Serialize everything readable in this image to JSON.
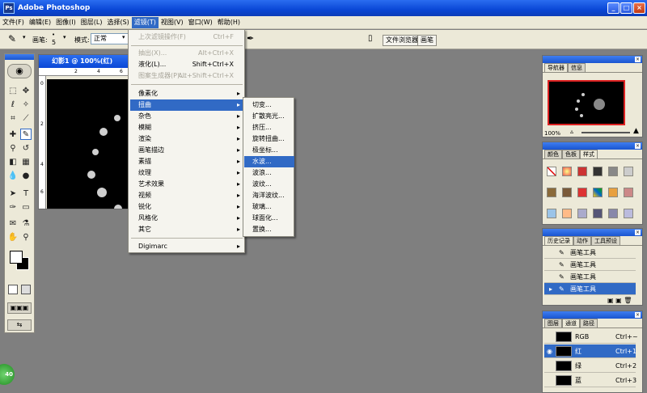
{
  "app": {
    "title": "Adobe Photoshop",
    "logo": "Ps"
  },
  "window_controls": {
    "minimize": "_",
    "maximize": "□",
    "close": "×"
  },
  "menubar": [
    "文件(F)",
    "编辑(E)",
    "图像(I)",
    "图层(L)",
    "选择(S)",
    "滤镜(T)",
    "视图(V)",
    "窗口(W)",
    "帮助(H)"
  ],
  "options": {
    "brush_label": "画笔:",
    "brush_size": "5",
    "mode_label": "模式:",
    "mode_value": "正常",
    "tab_file_browser": "文件浏览器",
    "tab_brushes": "画笔"
  },
  "document": {
    "title": "幻影1 @ 100%(红)",
    "ruler_marks": [
      "2",
      "4",
      "6",
      "0",
      "2",
      "4",
      "6"
    ]
  },
  "filter_menu": {
    "items": [
      {
        "label": "上次滤镜操作(F)",
        "shortcut": "Ctrl+F",
        "disabled": true
      },
      {
        "label": "抽出(X)...",
        "shortcut": "Alt+Ctrl+X",
        "disabled": true
      },
      {
        "label": "液化(L)...",
        "shortcut": "Shift+Ctrl+X",
        "disabled": false
      },
      {
        "label": "图案生成器(P)...",
        "shortcut": "Alt+Shift+Ctrl+X",
        "disabled": true
      },
      {
        "label": "像素化",
        "sub": true
      },
      {
        "label": "扭曲",
        "sub": true,
        "highlighted": true
      },
      {
        "label": "杂色",
        "sub": true
      },
      {
        "label": "模糊",
        "sub": true
      },
      {
        "label": "渲染",
        "sub": true
      },
      {
        "label": "画笔描边",
        "sub": true
      },
      {
        "label": "素描",
        "sub": true
      },
      {
        "label": "纹理",
        "sub": true
      },
      {
        "label": "艺术效果",
        "sub": true
      },
      {
        "label": "视频",
        "sub": true
      },
      {
        "label": "锐化",
        "sub": true
      },
      {
        "label": "风格化",
        "sub": true
      },
      {
        "label": "其它",
        "sub": true
      },
      {
        "label": "Digimarc",
        "sub": true
      }
    ]
  },
  "distort_submenu": [
    "切变...",
    "扩散亮光...",
    "挤压...",
    "旋转扭曲...",
    "极坐标...",
    "水波...",
    "波浪...",
    "波纹...",
    "海洋波纹...",
    "玻璃...",
    "球面化...",
    "置换..."
  ],
  "navigator": {
    "tabs": [
      "导航器",
      "信息"
    ],
    "zoom": "100%"
  },
  "color_panel": {
    "tabs": [
      "颜色",
      "色板",
      "样式"
    ]
  },
  "history": {
    "tabs": [
      "历史记录",
      "动作",
      "工具预设"
    ],
    "rows": [
      "画笔工具",
      "画笔工具",
      "画笔工具",
      "画笔工具"
    ]
  },
  "layers": {
    "tabs": [
      "图层",
      "通道",
      "路径"
    ],
    "channels": [
      {
        "name": "RGB",
        "shortcut": "Ctrl+~"
      },
      {
        "name": "红",
        "shortcut": "Ctrl+1",
        "highlighted": true
      },
      {
        "name": "绿",
        "shortcut": "Ctrl+2"
      },
      {
        "name": "蓝",
        "shortcut": "Ctrl+3"
      }
    ]
  },
  "taskbar": {
    "start": "40"
  },
  "colors": {
    "titlebar": "#0a47d6",
    "highlight": "#316ac5",
    "workspace": "#7f7f7f",
    "chrome": "#ece9d8"
  }
}
